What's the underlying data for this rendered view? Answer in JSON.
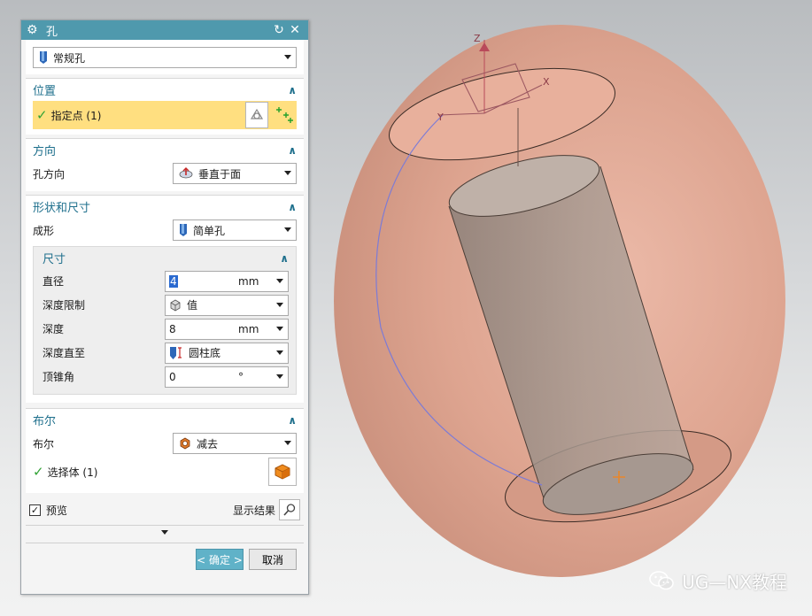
{
  "dialog": {
    "title": "孔",
    "type_select": {
      "value": "常规孔"
    },
    "position": {
      "header": "位置",
      "specify_point_label": "指定点 (1)"
    },
    "direction": {
      "header": "方向",
      "hole_direction_label": "孔方向",
      "hole_direction_value": "垂直于面"
    },
    "shape": {
      "header": "形状和尺寸",
      "form_label": "成形",
      "form_value": "简单孔",
      "dimensions": {
        "header": "尺寸",
        "diameter_label": "直径",
        "diameter_value": "4",
        "diameter_unit": "mm",
        "depth_limit_label": "深度限制",
        "depth_limit_value": "值",
        "depth_label": "深度",
        "depth_value": "8",
        "depth_unit": "mm",
        "depth_to_label": "深度直至",
        "depth_to_value": "圆柱底",
        "tip_angle_label": "顶锥角",
        "tip_angle_value": "0",
        "tip_angle_unit": "°"
      }
    },
    "boolean": {
      "header": "布尔",
      "boolean_label": "布尔",
      "boolean_value": "减去",
      "select_body_label": "选择体 (1)"
    },
    "preview_label": "预览",
    "preview_checked": true,
    "show_result_label": "显示结果",
    "ok_label": "< 确定 >",
    "cancel_label": "取消"
  },
  "viewport": {
    "axis_labels": {
      "z": "Z",
      "x": "X",
      "y": "Y"
    }
  },
  "watermark": {
    "text": "UG—NX教程"
  },
  "colors": {
    "titlebar": "#4f99ad",
    "section_header": "#1e6f8c",
    "selection_highlight": "#ffdf80",
    "check": "#32a336",
    "sphere": "#e2a48e"
  }
}
